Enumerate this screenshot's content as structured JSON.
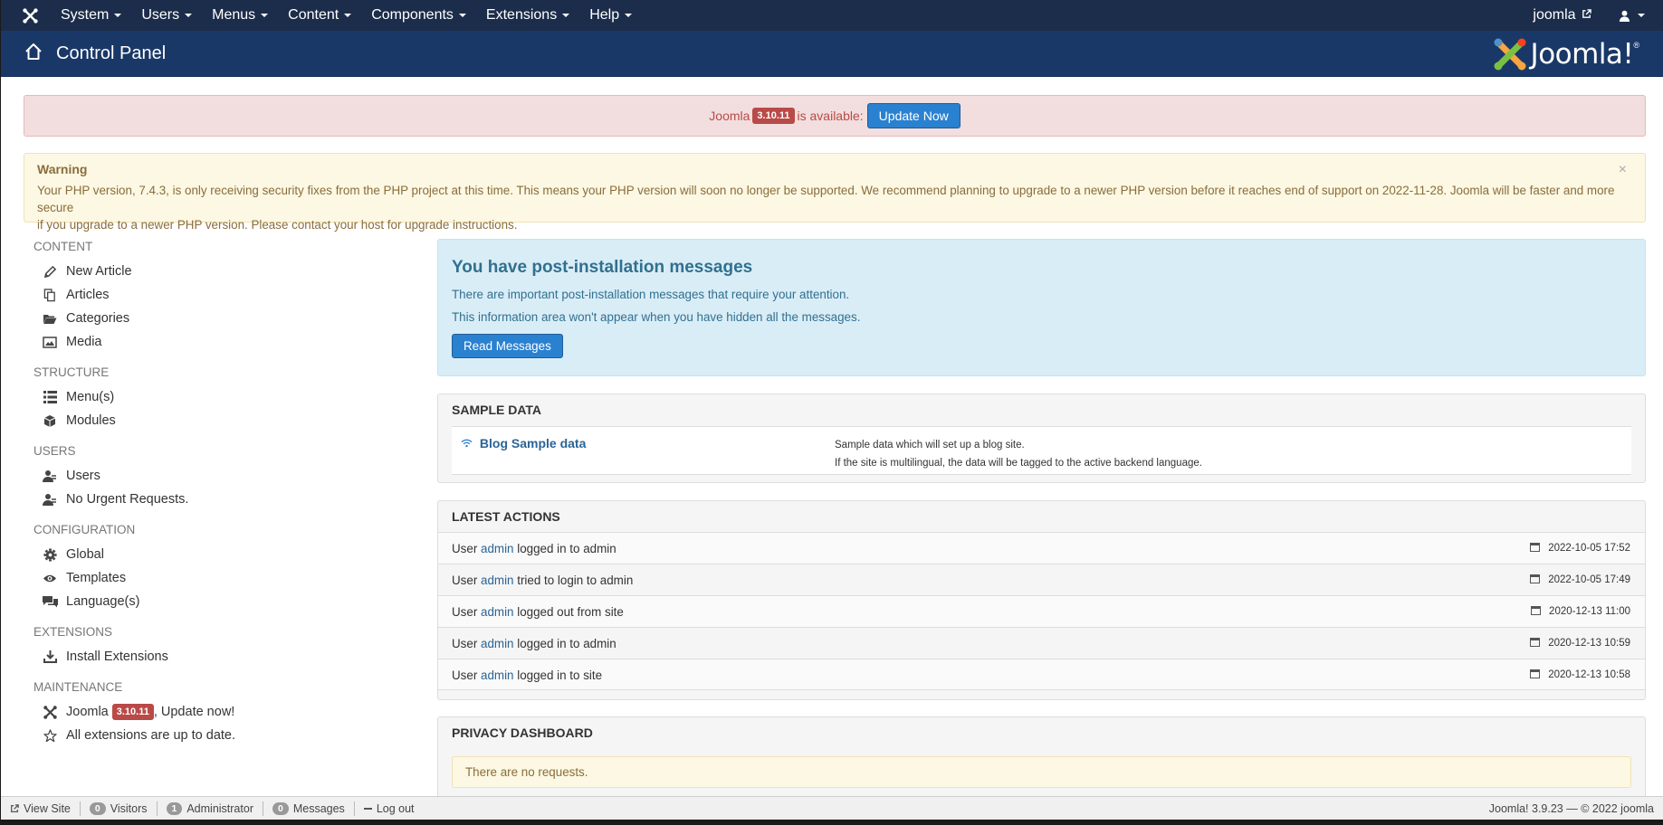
{
  "navbar": {
    "menu": [
      "System",
      "Users",
      "Menus",
      "Content",
      "Components",
      "Extensions",
      "Help"
    ],
    "site_link": "joomla"
  },
  "header": {
    "title": "Control Panel",
    "brand": "Joomla!",
    "brand_reg": "®"
  },
  "update_alert": {
    "prefix": "Joomla",
    "version": "3.10.11",
    "suffix": "is available:",
    "button": "Update Now"
  },
  "warning": {
    "title": "Warning",
    "line1": "Your PHP version, 7.4.3, is only receiving security fixes from the PHP project at this time. This means your PHP version will soon no longer be supported. We recommend planning to upgrade to a newer PHP version before it reaches end of support on 2022-11-28. Joomla will be faster and more secure",
    "line2": "if you upgrade to a newer PHP version. Please contact your host for upgrade instructions.",
    "close": "×"
  },
  "sidebar": {
    "content": {
      "heading": "CONTENT",
      "items": [
        "New Article",
        "Articles",
        "Categories",
        "Media"
      ]
    },
    "structure": {
      "heading": "STRUCTURE",
      "items": [
        "Menu(s)",
        "Modules"
      ]
    },
    "users": {
      "heading": "USERS",
      "items": [
        "Users",
        "No Urgent Requests."
      ]
    },
    "configuration": {
      "heading": "CONFIGURATION",
      "items": [
        "Global",
        "Templates",
        "Language(s)"
      ]
    },
    "extensions": {
      "heading": "EXTENSIONS",
      "items": [
        "Install Extensions"
      ]
    },
    "maintenance": {
      "heading": "MAINTENANCE",
      "joomla": "Joomla",
      "version": "3.10.11",
      "update": ", Update now!",
      "ext_status": "All extensions are up to date."
    }
  },
  "post_install": {
    "title": "You have post-installation messages",
    "line1": "There are important post-installation messages that require your attention.",
    "line2": "This information area won't appear when you have hidden all the messages.",
    "button": "Read Messages"
  },
  "sample_data": {
    "heading": "SAMPLE DATA",
    "item_title": "Blog Sample data",
    "desc1": "Sample data which will set up a blog site.",
    "desc2": "If the site is multilingual, the data will be tagged to the active backend language."
  },
  "latest_actions": {
    "heading": "LATEST ACTIONS",
    "rows": [
      {
        "pre": "User",
        "user": "admin",
        "action": "logged in to admin",
        "time": "2022-10-05 17:52"
      },
      {
        "pre": "User",
        "user": "admin",
        "action": "tried to login to admin",
        "time": "2022-10-05 17:49"
      },
      {
        "pre": "User",
        "user": "admin",
        "action": "logged out from site",
        "time": "2020-12-13 11:00"
      },
      {
        "pre": "User",
        "user": "admin",
        "action": "logged in to admin",
        "time": "2020-12-13 10:59"
      },
      {
        "pre": "User",
        "user": "admin",
        "action": "logged in to site",
        "time": "2020-12-13 10:58"
      }
    ]
  },
  "privacy": {
    "heading": "PRIVACY DASHBOARD",
    "message": "There are no requests."
  },
  "statusbar": {
    "view_site": "View Site",
    "visitors_count": "0",
    "visitors": "Visitors",
    "admins_count": "1",
    "admins": "Administrator",
    "messages_count": "0",
    "messages": "Messages",
    "logout": "Log out",
    "right": "Joomla! 3.9.23  —  © 2022 joomla"
  },
  "colors": {
    "navbar": "#1c2d4b",
    "header": "#1a3867",
    "accent": "#2a81d0",
    "danger": "#b94a48"
  }
}
